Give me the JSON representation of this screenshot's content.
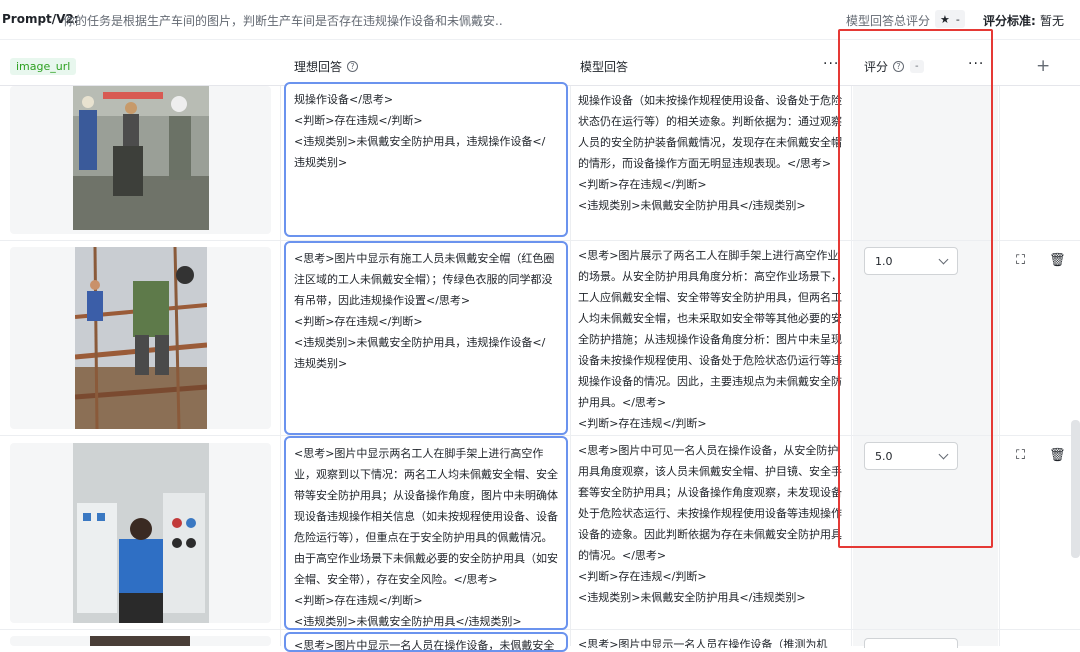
{
  "topbar": {
    "prompt_label": "Prompt/V2:",
    "prompt_text": "你的任务是根据生产车间的图片，判断生产车间是否存在违规操作设备和未佩戴安...",
    "score_label": "模型回答总评分",
    "score_value": "-",
    "std_label": "评分标准:",
    "std_value": "暂无"
  },
  "columns": {
    "image_url": "image_url",
    "ideal": "理想回答",
    "model": "模型回答",
    "score": "评分",
    "score_chip": "-",
    "more": "···",
    "add": "+"
  },
  "rows": [
    {
      "ideal": "规操作设备</思考>\n<判断>存在违规</判断>\n<违规类别>未佩戴安全防护用具，违规操作设备</\n违规类别>",
      "model": "规操作设备（如未按操作规程使用设备、设备处于危险状态仍在运行等）的相关迹象。判断依据为：通过观察人员的安全防护装备佩戴情况，发现存在未佩戴安全帽的情形，而设备操作方面无明显违规表现。</思考>\n<判断>存在违规</判断>\n<违规类别>未佩戴安全防护用具</违规类别>",
      "score": ""
    },
    {
      "ideal": "<思考>图片中显示有施工人员未佩戴安全帽（红色圈注区域的工人未佩戴安全帽）；传绿色衣服的同学都没有吊带，因此违规操作设置</思考>\n<判断>存在违规</判断>\n<违规类别>未佩戴安全防护用具，违规操作设备</\n违规类别>",
      "model": "<思考>图片展示了两名工人在脚手架上进行高空作业的场景。从安全防护用具角度分析：高空作业场景下，工人应佩戴安全帽、安全带等安全防护用具，但两名工人均未佩戴安全帽，也未采取如安全带等其他必要的安全防护措施；从违规操作设备角度分析：图片中未呈现设备未按操作规程使用、设备处于危险状态仍运行等违规操作设备的情况。因此，主要违规点为未佩戴安全防护用具。</思考>\n<判断>存在违规</判断>\n<违规类别>未佩戴安全防护用具</违规类别>",
      "score": "1.0"
    },
    {
      "ideal": "<思考>图片中显示两名工人在脚手架上进行高空作业，观察到以下情况：两名工人均未佩戴安全帽、安全带等安全防护用具；从设备操作角度，图片中未明确体现设备违规操作相关信息（如未按规程使用设备、设备危险运行等），但重点在于安全防护用具的佩戴情况。由于高空作业场景下未佩戴必要的安全防护用具（如安全帽、安全带），存在安全风险。</思考>\n<判断>存在违规</判断>\n<违规类别>未佩戴安全防护用具</违规类别>",
      "model": "<思考>图片中可见一名人员在操作设备，从安全防护用具角度观察，该人员未佩戴安全帽、护目镜、安全手套等安全防护用具；从设备操作角度观察，未发现设备处于危险状态运行、未按操作规程使用设备等违规操作设备的迹象。因此判断依据为存在未佩戴安全防护用具的情况。</思考>\n<判断>存在违规</判断>\n<违规类别>未佩戴安全防护用具</违规类别>",
      "score": "5.0"
    },
    {
      "ideal": "<思考>图片中显示一名人员在操作设备，未佩戴安全帽",
      "model": "<思考>图片中显示一名人员在操作设备（推测为机",
      "score": ""
    }
  ]
}
